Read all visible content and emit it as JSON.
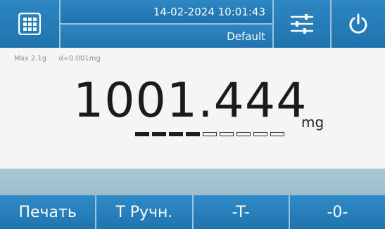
{
  "status": {
    "datetime": "14-02-2024 10:01:43",
    "profile": "Default"
  },
  "specs": {
    "max": "Max 2.1g",
    "readability": "d=0.001mg"
  },
  "display": {
    "reading": "1001.444",
    "unit": "mg"
  },
  "capacity_indicator": {
    "segments_total": 9,
    "segments_filled": 4,
    "fraction_filled": 0.444
  },
  "softkeys": {
    "print_label": "Печать",
    "manual_tare_label": "T Ручн.",
    "tare_label": "-T-",
    "zero_label": "-0-"
  },
  "icons": {
    "menu": "grid-menu-icon",
    "settings": "sliders-icon",
    "power": "power-icon"
  },
  "colors": {
    "accent": "#2584c1",
    "band": "#a3c4d1",
    "background": "#f1f3f4",
    "text": "#1b1b1b"
  }
}
